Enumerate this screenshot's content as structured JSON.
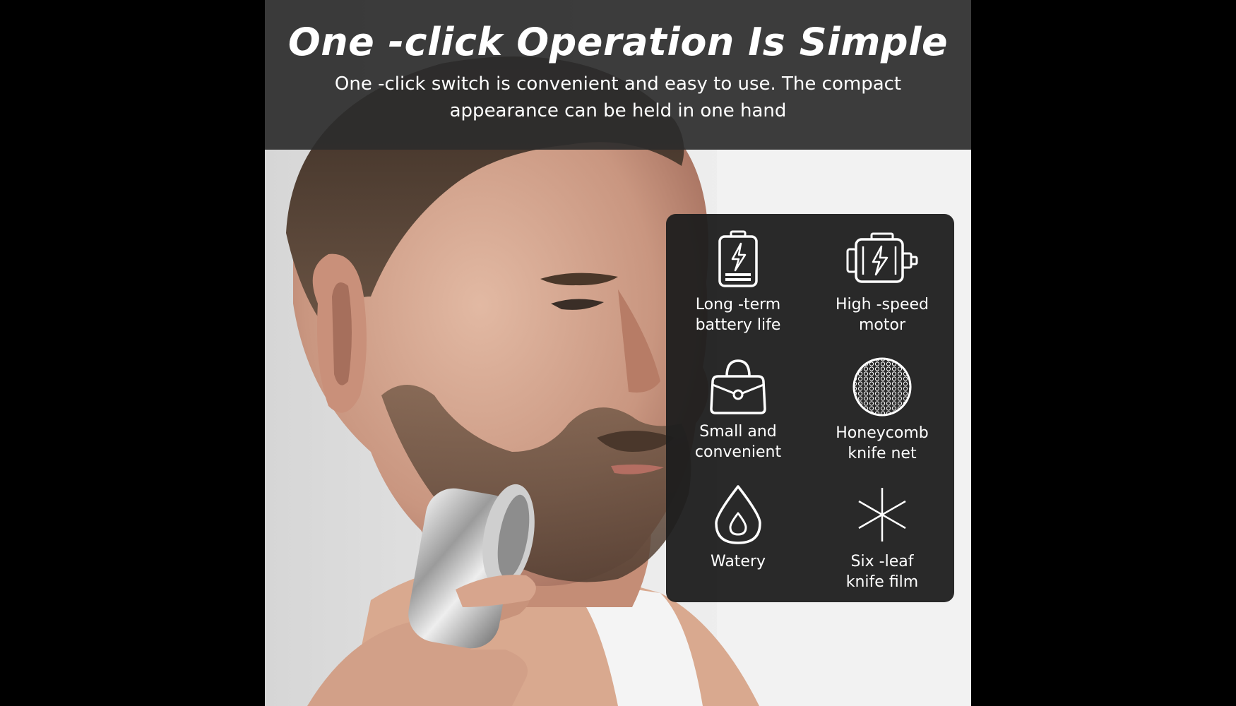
{
  "header": {
    "title": "One -click Operation Is Simple",
    "subtitle": "One -click switch is convenient and easy to use. The compact appearance can be held in one hand"
  },
  "features": [
    {
      "icon": "battery-icon",
      "label": "Long -term\nbattery life"
    },
    {
      "icon": "motor-icon",
      "label": "High -speed\nmotor"
    },
    {
      "icon": "handbag-icon",
      "label": "Small and\nconvenient"
    },
    {
      "icon": "honeycomb-icon",
      "label": "Honeycomb\nknife net"
    },
    {
      "icon": "water-drop-icon",
      "label": "Watery"
    },
    {
      "icon": "six-leaf-blade-icon",
      "label": "Six -leaf\nknife film"
    }
  ],
  "colors": {
    "background": "#000000",
    "header_band": "#2d2d2d",
    "panel": "#1e1e1e",
    "text": "#ffffff"
  }
}
